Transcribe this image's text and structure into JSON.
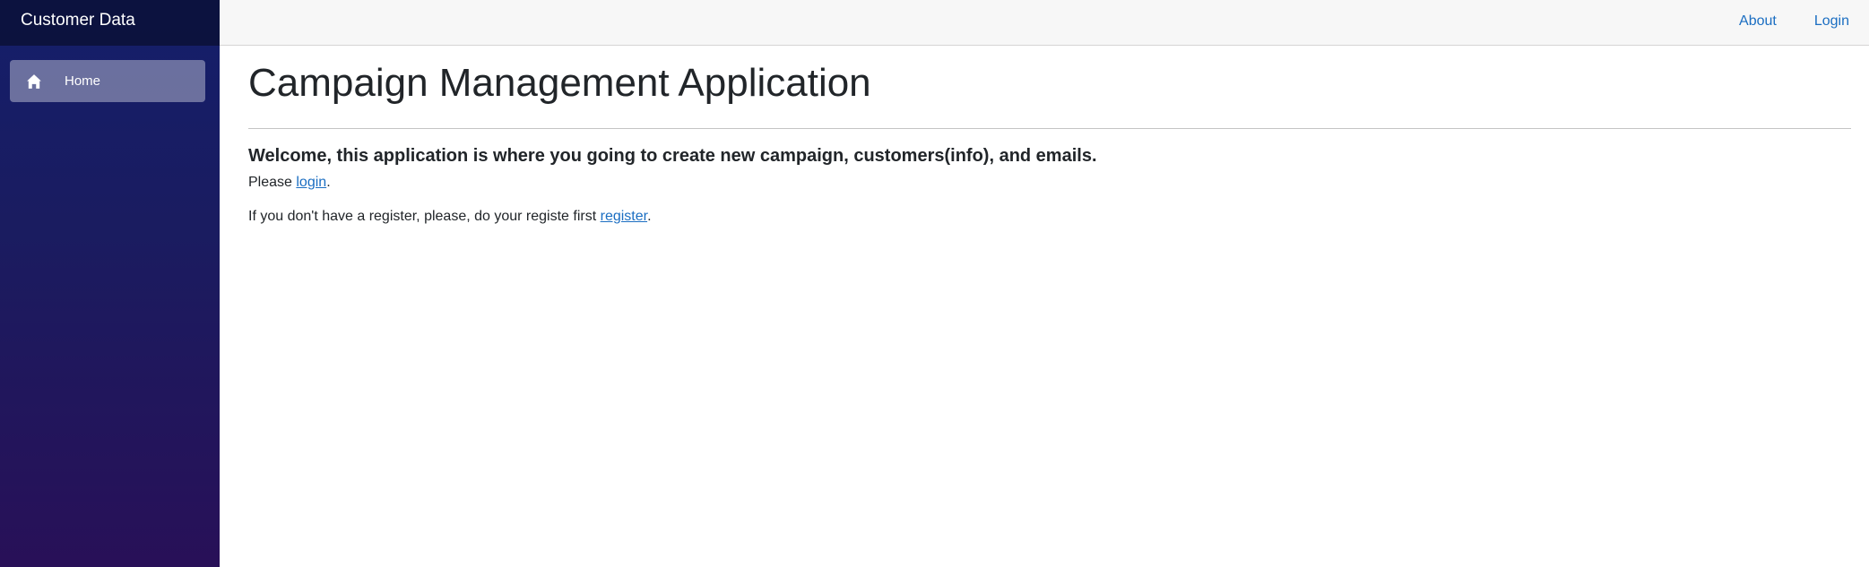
{
  "sidebar": {
    "brand": "Customer Data",
    "items": [
      {
        "label": "Home",
        "icon": "home-icon"
      }
    ]
  },
  "topbar": {
    "about_label": "About",
    "login_label": "Login"
  },
  "main": {
    "title": "Campaign Management Application",
    "welcome": "Welcome, this application is where you going to create new campaign, customers(info), and emails.",
    "p1_prefix": "Please ",
    "p1_link": "login",
    "p1_suffix": ".",
    "p2_prefix": "If you don't have a register, please, do your registe first ",
    "p2_link": "register",
    "p2_suffix": "."
  },
  "colors": {
    "link": "#1b6ec2",
    "sidebar_top": "#141e6a",
    "sidebar_bottom": "#281058",
    "topbar_bg": "#f7f7f7"
  }
}
